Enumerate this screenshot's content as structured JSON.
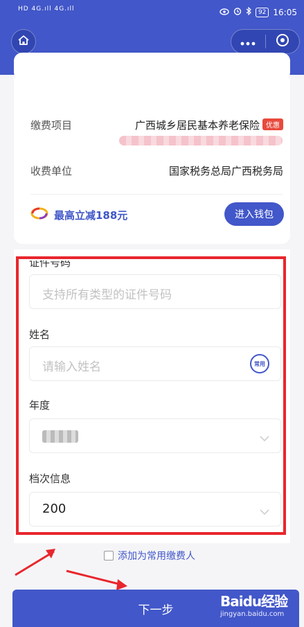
{
  "status_bar": {
    "network_left": "HD 4G.ıll 4G.ıll",
    "battery": "92",
    "time": "16:05"
  },
  "form_header_partial": "证件号码",
  "payment": {
    "item_label": "缴费项目",
    "item_value": "广西城乡居民基本养老保险",
    "item_tag": "优惠",
    "unit_label": "收费单位",
    "unit_value": "国家税务总局广西税务局"
  },
  "promo": {
    "text": "最高立减188元",
    "wallet_button": "进入钱包"
  },
  "form": {
    "id_placeholder": "支持所有类型的证件号码",
    "name_label": "姓名",
    "name_placeholder": "请输入姓名",
    "name_badge": "常用",
    "year_label": "年度",
    "tier_label": "档次信息",
    "tier_value": "200"
  },
  "add_common_payer": "添加为常用缴费人",
  "next_button": "下一步",
  "watermark": {
    "brand": "Baidu经验",
    "url": "jingyan.baidu.com"
  },
  "colors": {
    "primary": "#4257c9",
    "highlight_frame": "#e8262d",
    "tag": "#e84a3c"
  }
}
